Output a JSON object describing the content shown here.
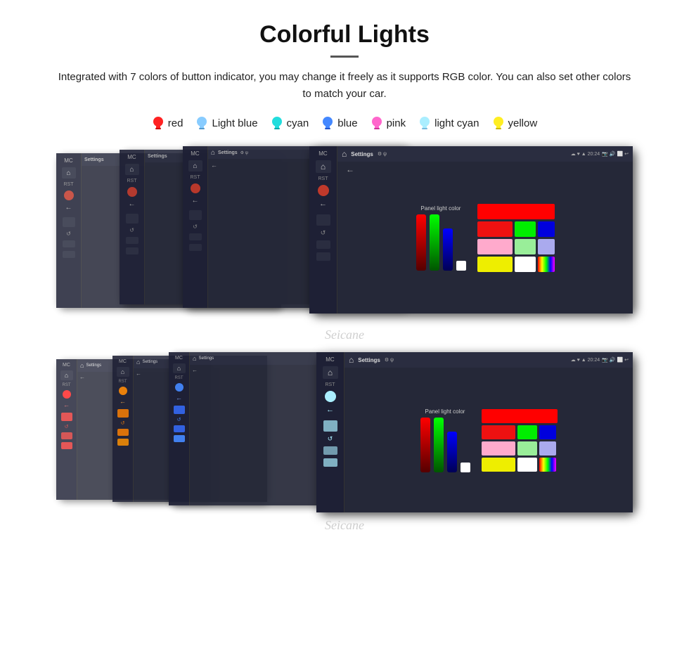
{
  "header": {
    "title": "Colorful Lights",
    "description": "Integrated with 7 colors of button indicator, you may change it freely as it supports RGB color. You can also set other colors to match your car."
  },
  "colors": [
    {
      "name": "red",
      "color": "#ff2222",
      "label": "red"
    },
    {
      "name": "light-blue",
      "color": "#88ccff",
      "label": "Light blue"
    },
    {
      "name": "cyan",
      "color": "#22dddd",
      "label": "cyan"
    },
    {
      "name": "blue",
      "color": "#4488ff",
      "label": "blue"
    },
    {
      "name": "pink",
      "color": "#ff66cc",
      "label": "pink"
    },
    {
      "name": "light-cyan",
      "color": "#aaeeff",
      "label": "light cyan"
    },
    {
      "name": "yellow",
      "color": "#ffee22",
      "label": "yellow"
    }
  ],
  "device": {
    "settings_label": "Settings",
    "time": "20:24",
    "panel_light_label": "Panel light color"
  },
  "watermark": {
    "text": "Seicane"
  }
}
